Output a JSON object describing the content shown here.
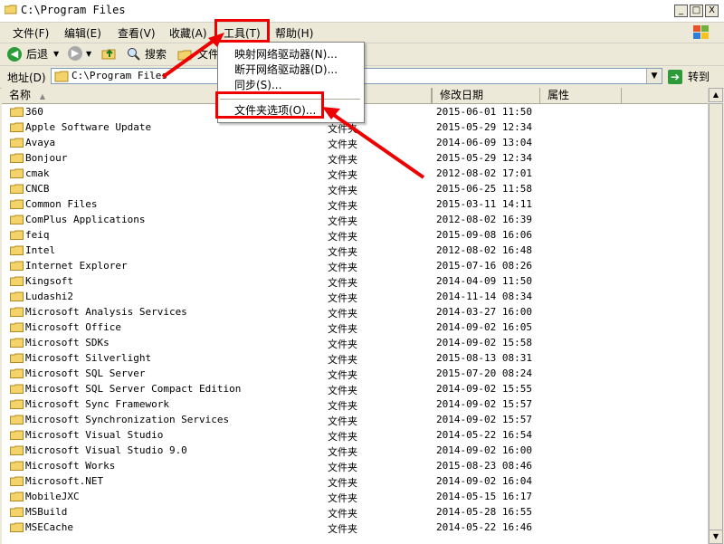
{
  "window": {
    "title": "C:\\Program Files",
    "buttons": {
      "minimize": "_",
      "maximize": "□",
      "close": "X"
    }
  },
  "menubar": {
    "items": [
      {
        "label": "文件(F)"
      },
      {
        "label": "编辑(E)"
      },
      {
        "label": "查看(V)"
      },
      {
        "label": "收藏(A)"
      },
      {
        "label": "工具(T)"
      },
      {
        "label": "帮助(H)"
      }
    ]
  },
  "toolbar": {
    "back": "后退",
    "search": "搜索",
    "folders": "文件"
  },
  "address": {
    "label": "地址(D)",
    "value": "C:\\Program Files",
    "go": "转到"
  },
  "tools_menu": {
    "items": [
      {
        "label": "映射网络驱动器(N)..."
      },
      {
        "label": "断开网络驱动器(D)..."
      },
      {
        "label": "同步(S)..."
      },
      {
        "label": "文件夹选项(O)..."
      }
    ]
  },
  "list": {
    "columns": [
      "名称",
      "修改日期",
      "属性"
    ],
    "type_label": "文件夹",
    "files": [
      {
        "name": "360",
        "date": "2015-06-01 11:50"
      },
      {
        "name": "Apple Software Update",
        "date": "2015-05-29 12:34"
      },
      {
        "name": "Avaya",
        "date": "2014-06-09 13:04"
      },
      {
        "name": "Bonjour",
        "date": "2015-05-29 12:34"
      },
      {
        "name": "cmak",
        "date": "2012-08-02 17:01"
      },
      {
        "name": "CNCB",
        "date": "2015-06-25 11:58"
      },
      {
        "name": "Common Files",
        "date": "2015-03-11 14:11"
      },
      {
        "name": "ComPlus Applications",
        "date": "2012-08-02 16:39"
      },
      {
        "name": "feiq",
        "date": "2015-09-08 16:06"
      },
      {
        "name": "Intel",
        "date": "2012-08-02 16:48"
      },
      {
        "name": "Internet Explorer",
        "date": "2015-07-16 08:26"
      },
      {
        "name": "Kingsoft",
        "date": "2014-04-09 11:50"
      },
      {
        "name": "Ludashi2",
        "date": "2014-11-14 08:34"
      },
      {
        "name": "Microsoft Analysis Services",
        "date": "2014-03-27 16:00"
      },
      {
        "name": "Microsoft Office",
        "date": "2014-09-02 16:05"
      },
      {
        "name": "Microsoft SDKs",
        "date": "2014-09-02 15:58"
      },
      {
        "name": "Microsoft Silverlight",
        "date": "2015-08-13 08:31"
      },
      {
        "name": "Microsoft SQL Server",
        "date": "2015-07-20 08:24"
      },
      {
        "name": "Microsoft SQL Server Compact Edition",
        "date": "2014-09-02 15:55"
      },
      {
        "name": "Microsoft Sync Framework",
        "date": "2014-09-02 15:57"
      },
      {
        "name": "Microsoft Synchronization Services",
        "date": "2014-09-02 15:57"
      },
      {
        "name": "Microsoft Visual Studio",
        "date": "2014-05-22 16:54"
      },
      {
        "name": "Microsoft Visual Studio 9.0",
        "date": "2014-09-02 16:00"
      },
      {
        "name": "Microsoft Works",
        "date": "2015-08-23 08:46"
      },
      {
        "name": "Microsoft.NET",
        "date": "2014-09-02 16:04"
      },
      {
        "name": "MobileJXC",
        "date": "2014-05-15 16:17"
      },
      {
        "name": "MSBuild",
        "date": "2014-05-28 16:55"
      },
      {
        "name": "MSECache",
        "date": "2014-05-22 16:46"
      }
    ]
  },
  "colors": {
    "highlight": "#e00000",
    "folder": "#f3d36a",
    "chrome": "#ece9d8"
  }
}
